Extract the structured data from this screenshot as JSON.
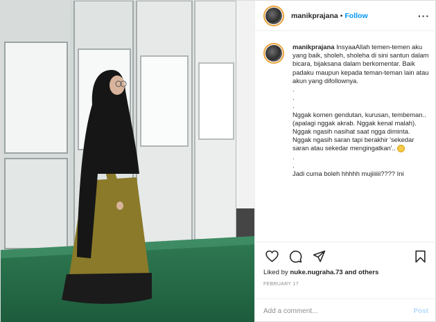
{
  "post": {
    "username": "manikprajana",
    "separator": "•",
    "follow_label": "Follow",
    "more_label": "···",
    "caption_user": "manikprajana",
    "caption_text": "InsyaaAllah temen-temen aku yang baik, sholeh, sholeha di sini santun dalam bicara, bijaksana dalam berkomentar. Baik padaku maupun kepada teman-teman lain atau akun yang difollownya.\n.\n.\n.\nNggak komen gendutan, kurusan, tembeman.. (apalagi nggak akrab. Nggak kenal malah).\nNggak ngasih nasihat saat ngga diminta.\nNggak ngasih saran tapi berakhir 'sekedar saran atau sekedar mengingatkan'..",
    "caption_tail": ".\n.\nJadi cuma boleh hhhhh mujiiiiii???? Ini",
    "likes_prefix": "Liked by",
    "likes_user": "nuke.nugraha.73",
    "likes_suffix": "and others",
    "date": "February 17"
  },
  "comment_box": {
    "placeholder": "Add a comment...",
    "post_label": "Post"
  },
  "icons": [
    "heart-icon",
    "comment-icon",
    "share-icon",
    "bookmark-icon"
  ],
  "colors": {
    "accent": "#0095f6",
    "post_disabled": "#b3dbff",
    "muted": "#8e8e8e"
  }
}
